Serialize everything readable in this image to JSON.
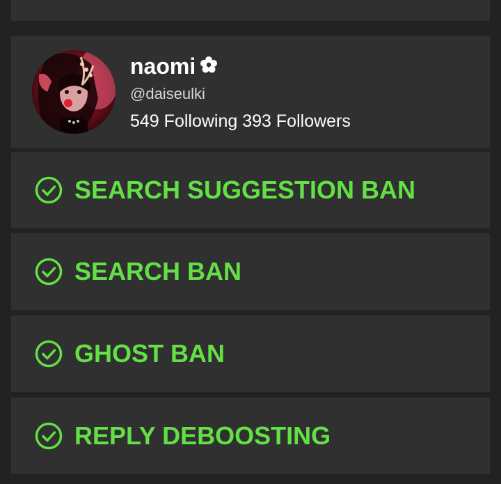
{
  "profile": {
    "display_name": "naomi",
    "handle": "@daiseulki",
    "following_count": "549",
    "following_label": "Following",
    "followers_count": "393",
    "followers_label": "Followers"
  },
  "status_checks": [
    {
      "label": "SEARCH SUGGESTION BAN",
      "icon": "check-circle-icon"
    },
    {
      "label": "SEARCH BAN",
      "icon": "check-circle-icon"
    },
    {
      "label": "GHOST BAN",
      "icon": "check-circle-icon"
    },
    {
      "label": "REPLY DEBOOSTING",
      "icon": "check-circle-icon"
    }
  ],
  "colors": {
    "background": "#222222",
    "card": "#303030",
    "accent_green": "#62e045",
    "text_primary": "#ffffff",
    "text_secondary": "#d8d8d8"
  }
}
